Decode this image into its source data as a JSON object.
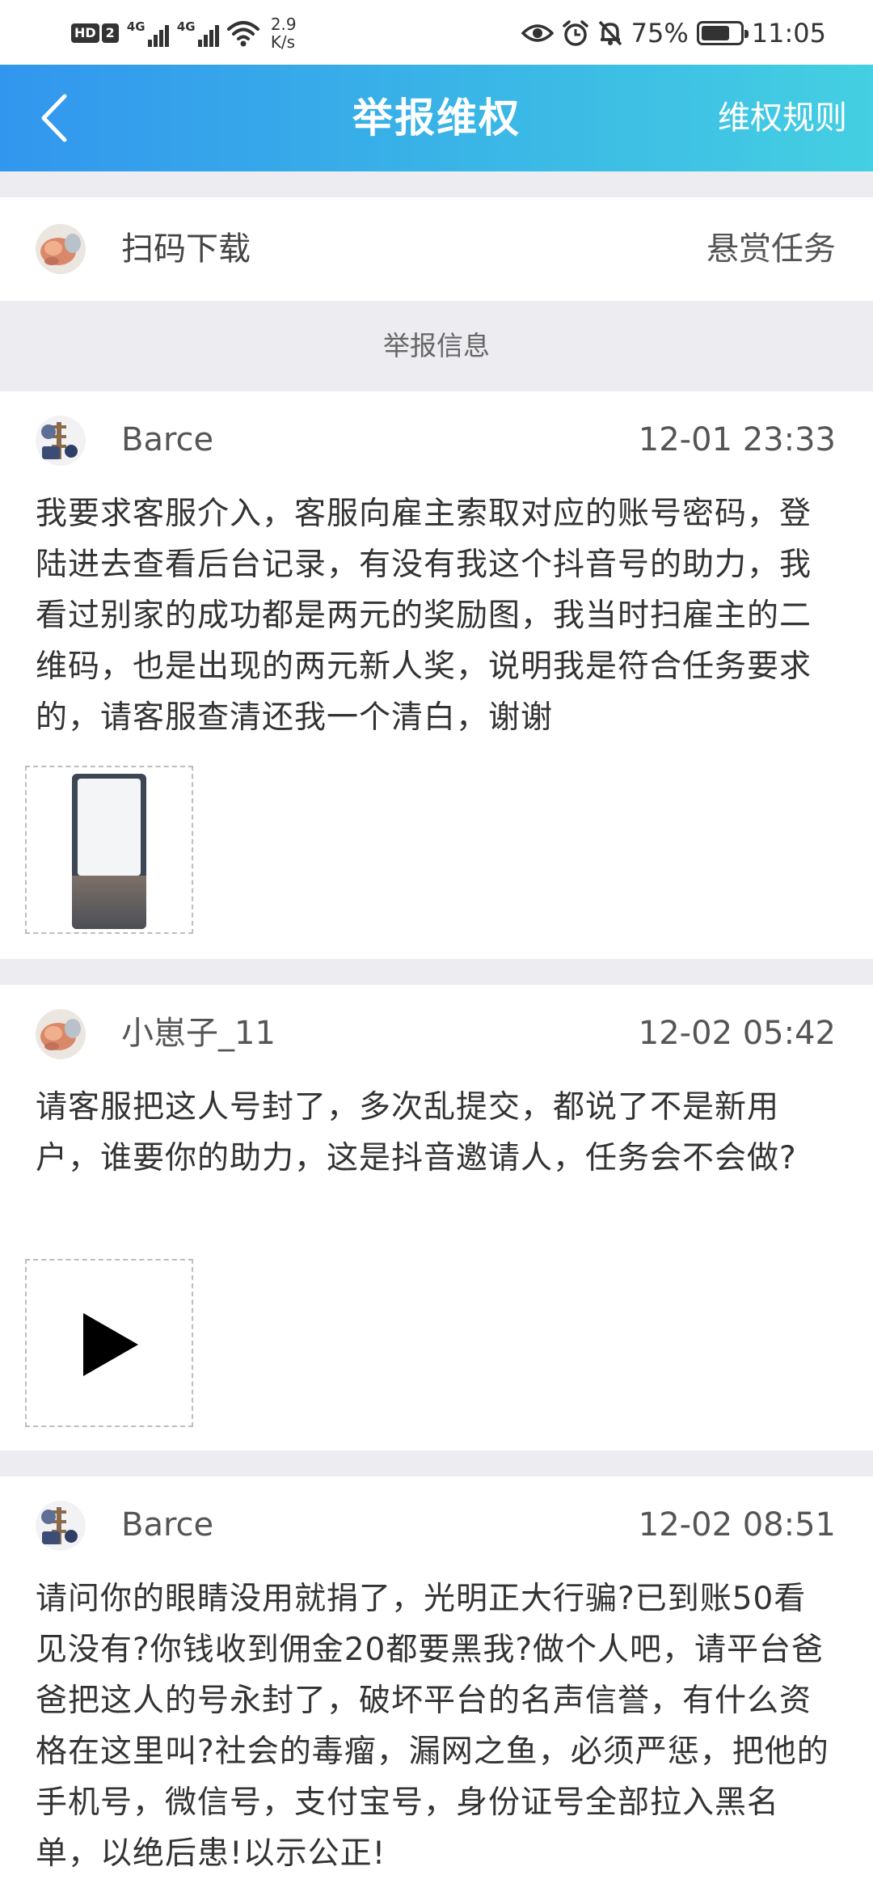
{
  "status_bar": {
    "hd_label": "HD",
    "sim_number": "2",
    "signal_1_tag": "4G",
    "signal_2_tag": "4G",
    "net_speed_value": "2.9",
    "net_speed_unit": "K/s",
    "battery_percent": "75%",
    "battery_level": 0.75,
    "time": "11:05",
    "icons": [
      "eye-icon",
      "alarm-icon",
      "bell-off-icon",
      "battery-icon"
    ]
  },
  "header": {
    "title": "举报维权",
    "rules_link": "维权规则",
    "back_icon": "chevron-left-icon",
    "gradient_start": "#3296ee",
    "gradient_end": "#44cfe2"
  },
  "task": {
    "name": "扫码下载",
    "type": "悬赏任务"
  },
  "section_label": "举报信息",
  "reports": [
    {
      "username": "Barce",
      "time": "12-01 23:33",
      "text": "我要求客服介入，客服向雇主索取对应的账号密码，登陆进去查看后台记录，有没有我这个抖音号的助力，我看过别家的成功都是两元的奖励图，我当时扫雇主的二维码，也是出现的两元新人奖，说明我是符合任务要求的，请客服查清还我一个清白，谢谢",
      "attachment": "image"
    },
    {
      "username": "小崽子_11",
      "time": "12-02 05:42",
      "text": "请客服把这人号封了，多次乱提交，都说了不是新用户，谁要你的助力，这是抖音邀请人，任务会不会做?",
      "attachment": "video"
    },
    {
      "username": "Barce",
      "time": "12-02 08:51",
      "text": "请问你的眼睛没用就捐了，光明正大行骗?已到账50看见没有?你钱收到佣金20都要黑我?做个人吧，请平台爸爸把这人的号永封了，破坏平台的名声信誉，有什么资格在这里叫?社会的毒瘤，漏网之鱼，必须严惩，把他的手机号，微信号，支付宝号，身份证号全部拉入黑名单，以绝后患!以示公正!"
    }
  ]
}
